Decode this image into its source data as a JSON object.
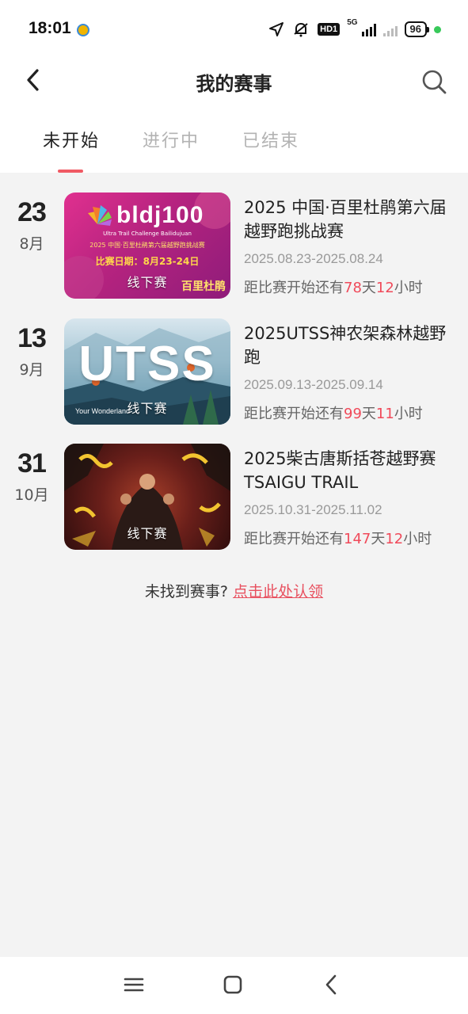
{
  "status_bar": {
    "time": "18:01",
    "network_type": "5G",
    "hd_label": "HD1",
    "battery": "96"
  },
  "header": {
    "title": "我的赛事",
    "back_icon": "back-arrow-icon",
    "search_icon": "search-icon"
  },
  "tabs": [
    {
      "label": "未开始",
      "active": true
    },
    {
      "label": "进行中",
      "active": false
    },
    {
      "label": "已结束",
      "active": false
    }
  ],
  "events": [
    {
      "day": "23",
      "month": "8月",
      "title": "2025 中国·百里杜鹃第六届越野跑挑战赛",
      "dates": "2025.08.23-2025.08.24",
      "count_prefix": "距比赛开始还有",
      "days": "78",
      "days_unit": "天",
      "hours": "12",
      "hours_unit": "小时",
      "tag": "线下赛",
      "poster": {
        "logo": "bldj100",
        "subtitle": "Ultra Trail Challenge Bailidujuan",
        "cn_title": "2025 中国·百里杜鹃第六届越野跑挑战赛",
        "date_text": "比赛日期：8月23-24日",
        "brand": "百里杜鹃"
      }
    },
    {
      "day": "13",
      "month": "9月",
      "title": "2025UTSS神农架森林越野跑",
      "dates": "2025.09.13-2025.09.14",
      "count_prefix": "距比赛开始还有",
      "days": "99",
      "days_unit": "天",
      "hours": "11",
      "hours_unit": "小时",
      "tag": "线下赛",
      "poster": {
        "logo": "UTSS",
        "brand": "Your Wonderland"
      }
    },
    {
      "day": "31",
      "month": "10月",
      "title": "2025柴古唐斯括苍越野赛TSAIGU TRAIL",
      "dates": "2025.10.31-2025.11.02",
      "count_prefix": "距比赛开始还有",
      "days": "147",
      "days_unit": "天",
      "hours": "12",
      "hours_unit": "小时",
      "tag": "线下赛"
    }
  ],
  "footer": {
    "not_found": "未找到赛事?",
    "claim_link": "点击此处认领"
  },
  "colors": {
    "accent": "#f05a64",
    "count_highlight": "#f04a5a",
    "background": "#f3f3f3"
  }
}
